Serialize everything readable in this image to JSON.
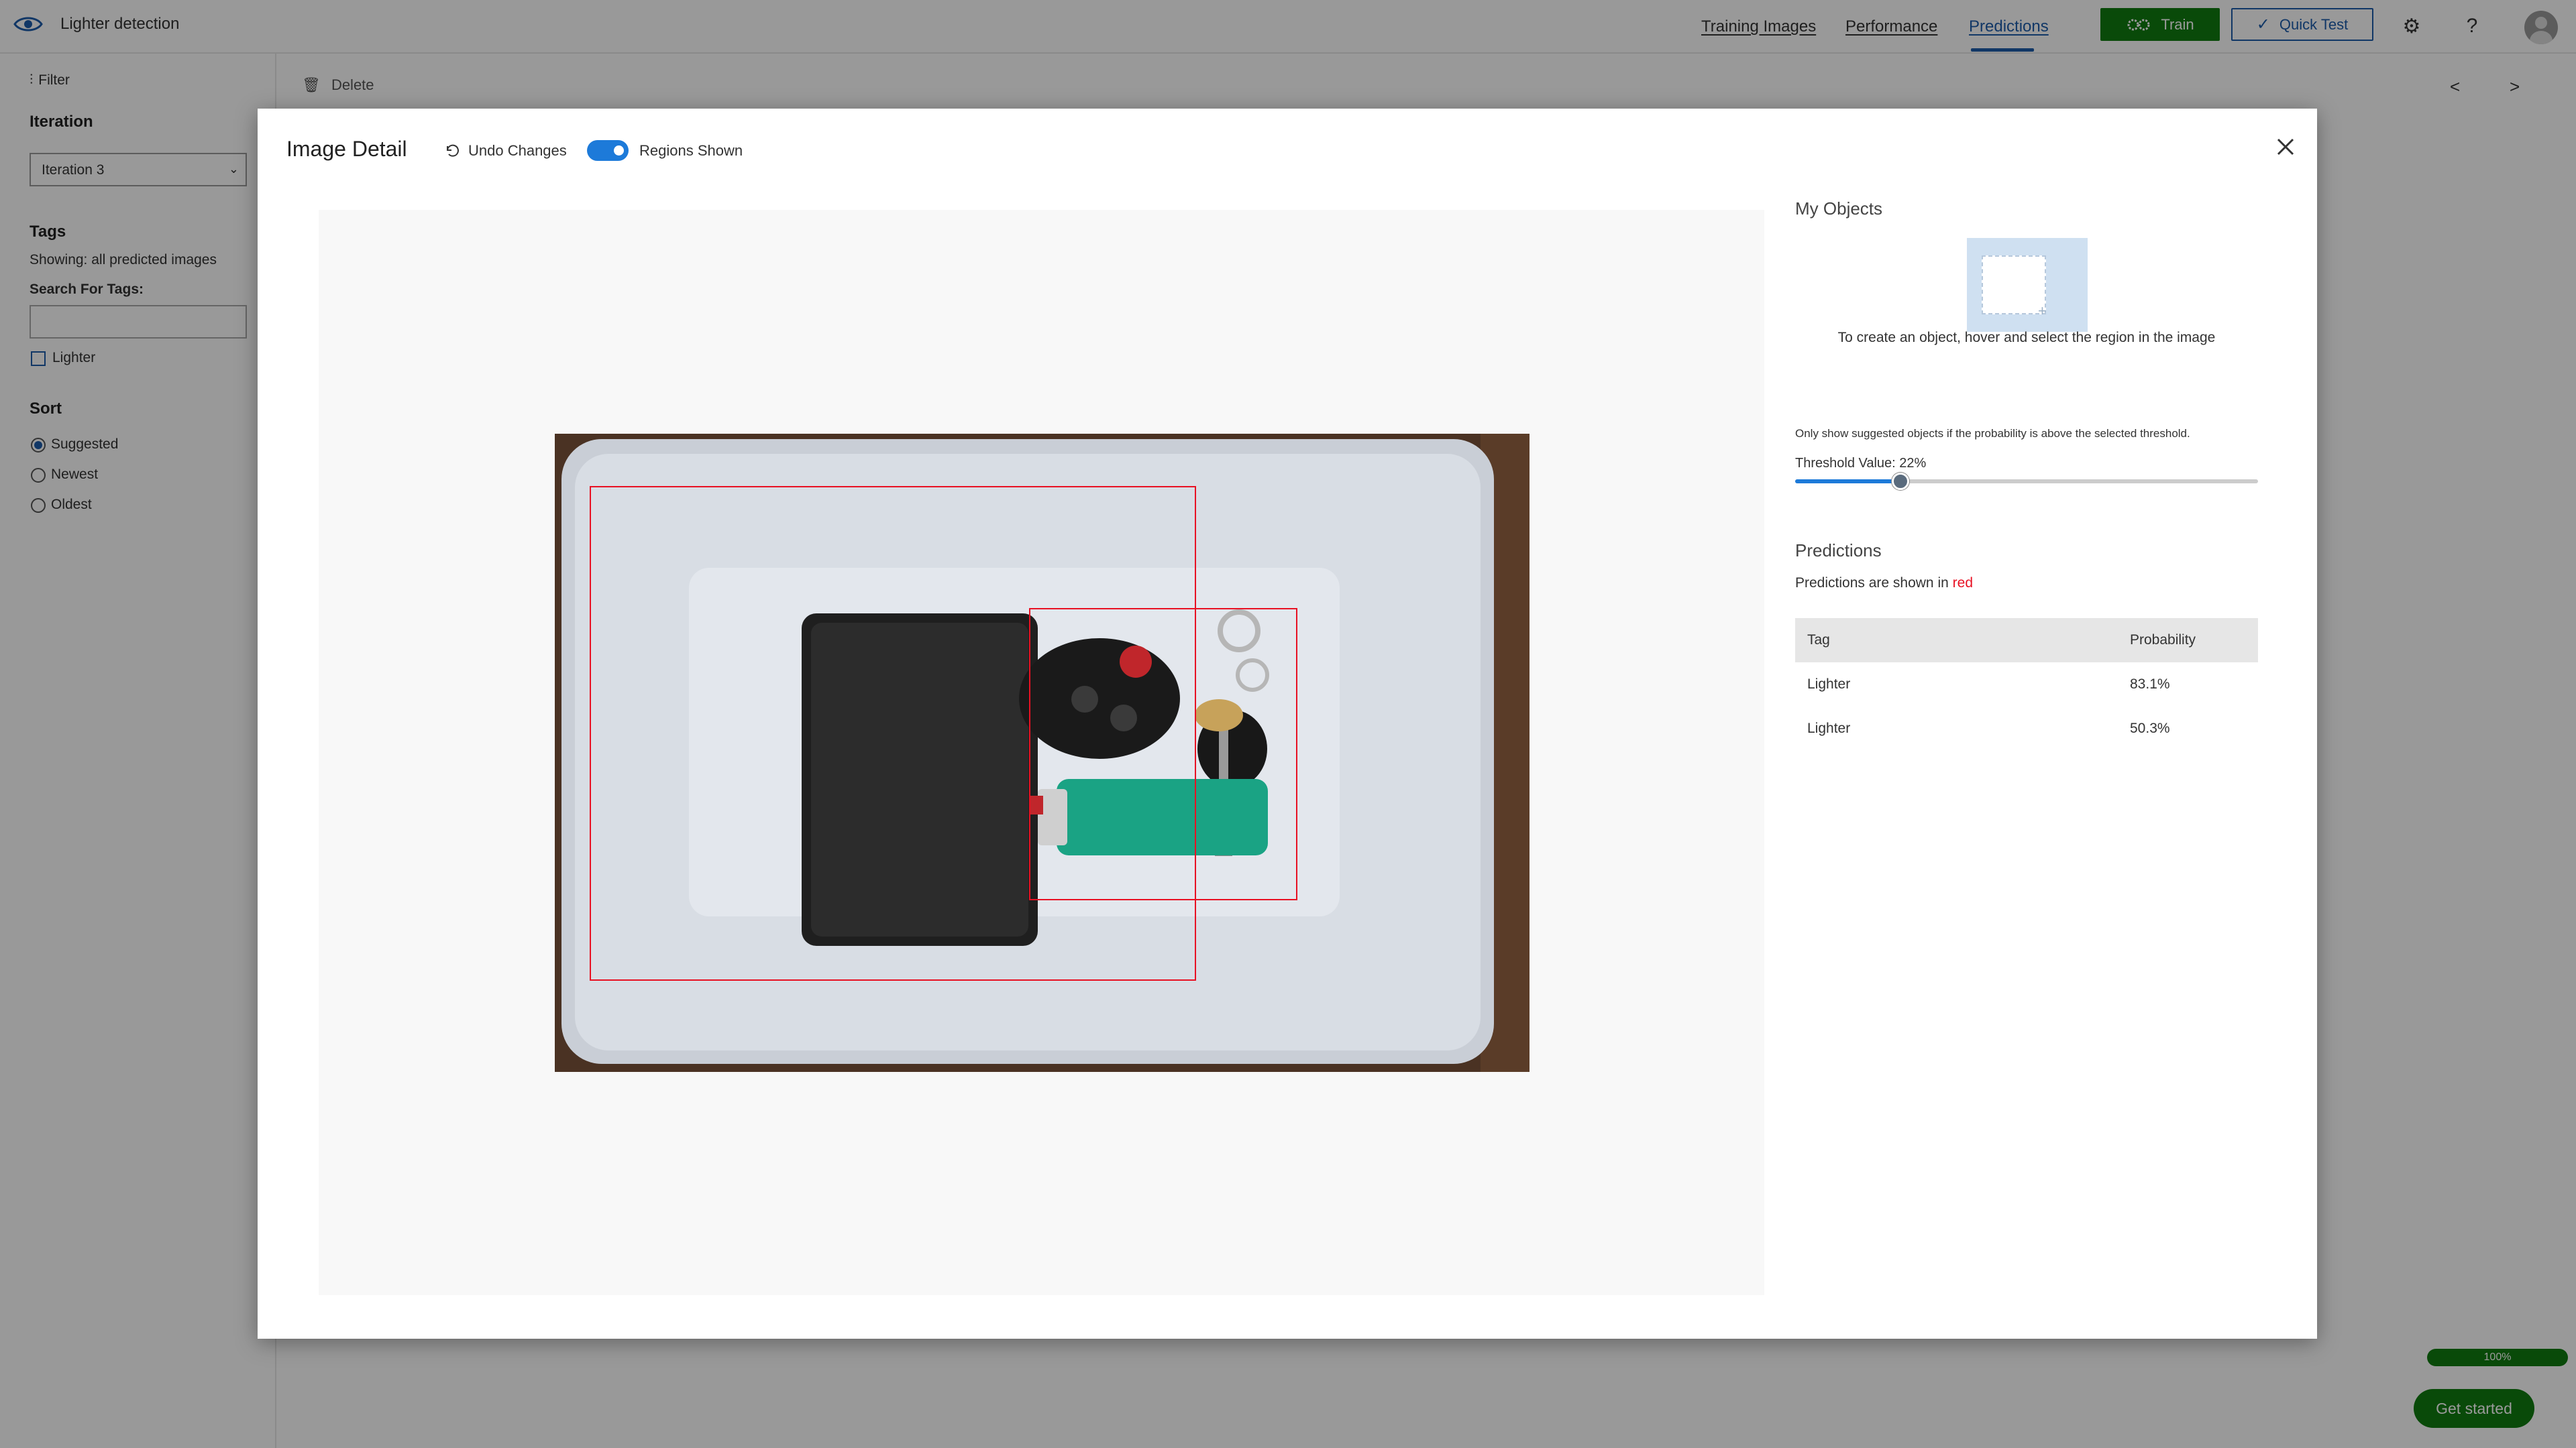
{
  "app": {
    "title": "Lighter detection"
  },
  "nav": {
    "tabs": [
      {
        "label": "Training Images"
      },
      {
        "label": "Performance"
      },
      {
        "label": "Predictions",
        "active": true
      }
    ],
    "train_label": "Train",
    "quick_test_label": "Quick Test",
    "settings_icon": "gear-icon",
    "help_label": "?"
  },
  "sidebar": {
    "filter_label": "Filter",
    "iteration_heading": "Iteration",
    "iteration_value": "Iteration 3",
    "tags_heading": "Tags",
    "showing_text": "Showing: all predicted images",
    "search_label": "Search For Tags:",
    "tag_items": [
      {
        "label": "Lighter",
        "checked": false
      }
    ],
    "sort_heading": "Sort",
    "sort_options": [
      {
        "label": "Suggested",
        "selected": true
      },
      {
        "label": "Newest",
        "selected": false
      },
      {
        "label": "Oldest",
        "selected": false
      }
    ]
  },
  "toolbar": {
    "delete_label": "Delete",
    "prev_label": "<",
    "next_label": ">"
  },
  "footer": {
    "progress_label": "100%",
    "get_started_label": "Get started"
  },
  "modal": {
    "title": "Image Detail",
    "undo_label": "Undo Changes",
    "regions_toggle_label": "Regions Shown",
    "regions_shown": true,
    "my_objects_heading": "My Objects",
    "create_hint": "To create an object, hover and select the region in the image",
    "threshold_note": "Only show suggested objects if the probability is above the selected threshold.",
    "threshold_label": "Threshold Value: 22%",
    "threshold_value": 0.22,
    "predictions_heading": "Predictions",
    "predictions_note_prefix": "Predictions are shown in",
    "predictions_note_color_word": "red",
    "table": {
      "headers": {
        "tag": "Tag",
        "probability": "Probability"
      },
      "rows": [
        {
          "tag": "Lighter",
          "probability": "83.1%"
        },
        {
          "tag": "Lighter",
          "probability": "50.3%"
        }
      ]
    }
  },
  "colors": {
    "accent": "#1d5cab",
    "train_green": "#107c10",
    "prediction_red": "#e81123",
    "toggle_blue": "#1d7ad9"
  }
}
